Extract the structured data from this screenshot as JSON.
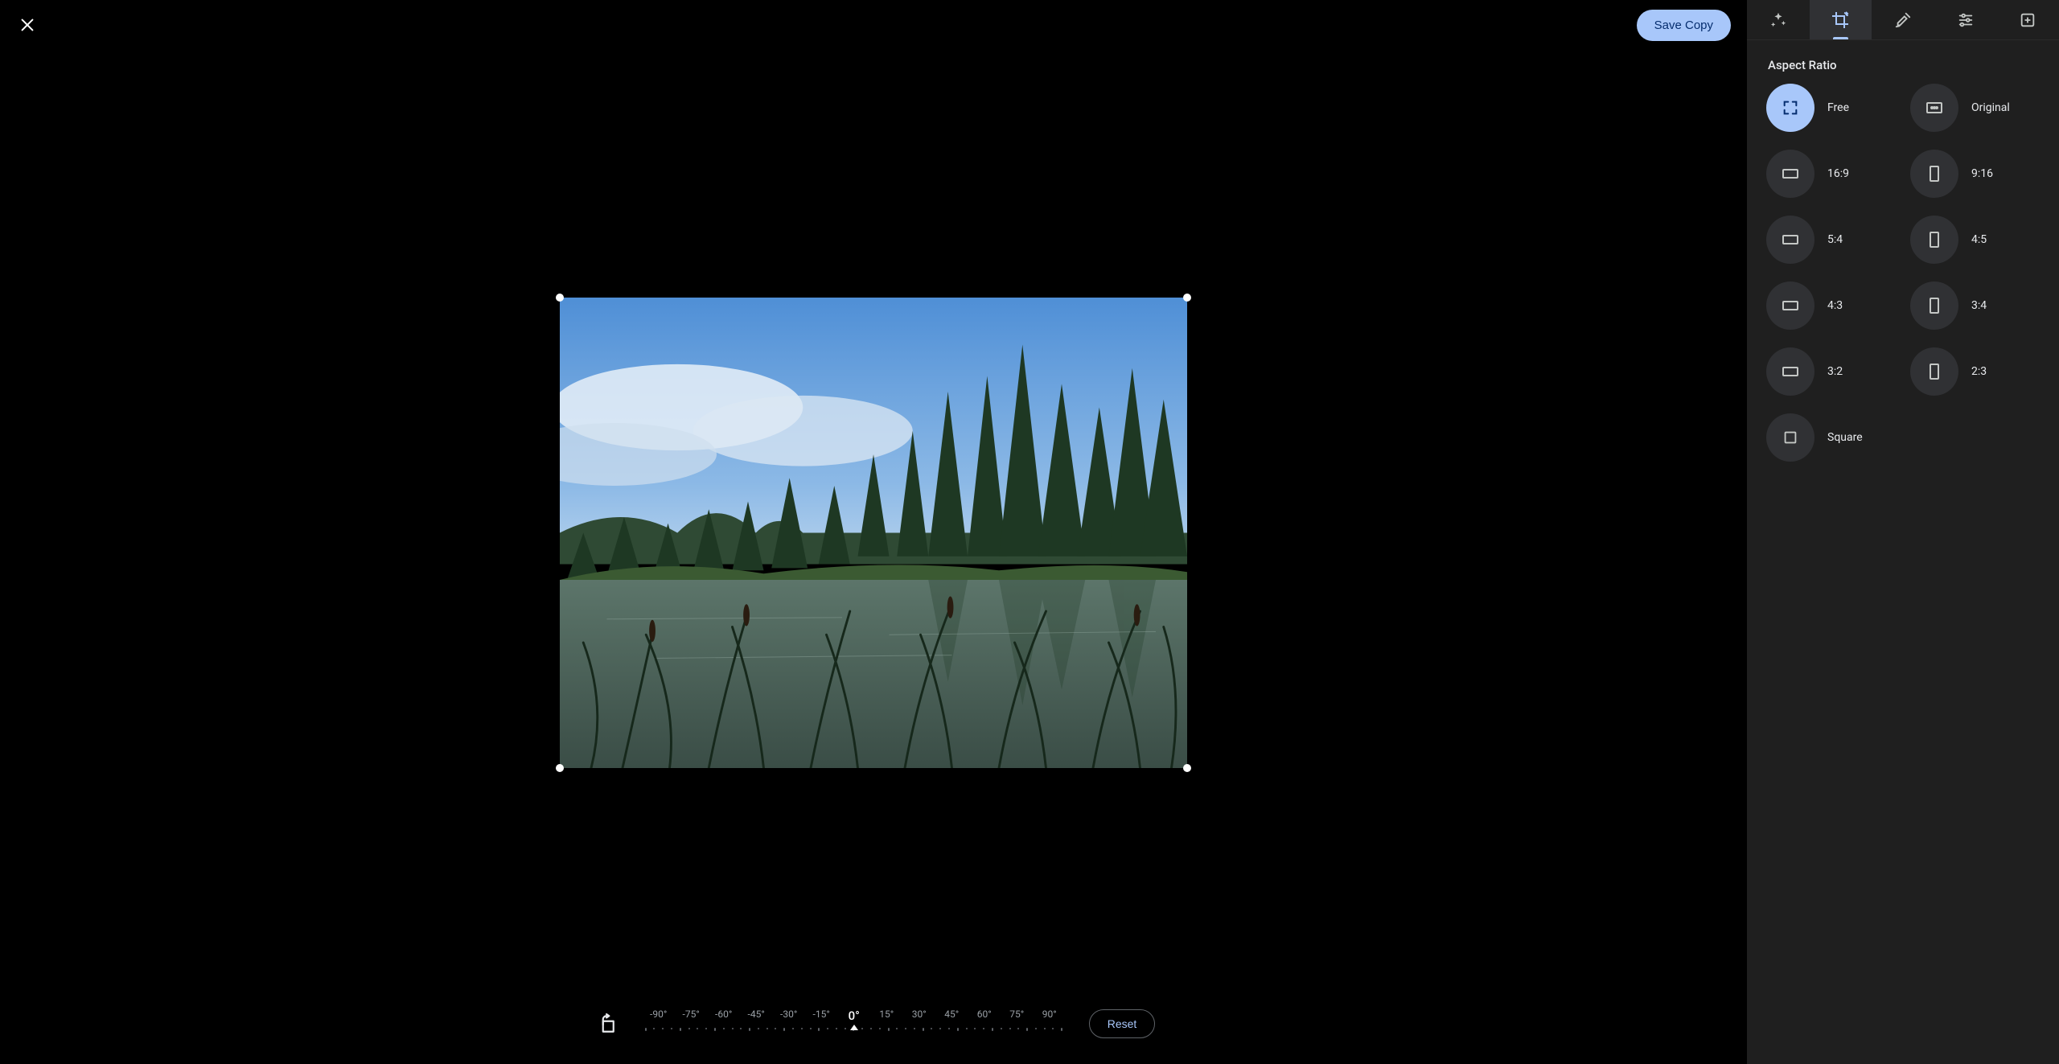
{
  "topbar": {
    "save_label": "Save Copy"
  },
  "rotate": {
    "reset_label": "Reset",
    "ticks": [
      "-90°",
      "-75°",
      "-60°",
      "-45°",
      "-30°",
      "-15°",
      "0°",
      "15°",
      "30°",
      "45°",
      "60°",
      "75°",
      "90°"
    ],
    "current_index": 6
  },
  "sidebar": {
    "tabs": [
      {
        "id": "enhance",
        "active": false
      },
      {
        "id": "crop",
        "active": true
      },
      {
        "id": "tools",
        "active": false
      },
      {
        "id": "adjust",
        "active": false
      },
      {
        "id": "more",
        "active": false
      }
    ],
    "section_title": "Aspect Ratio",
    "ratios": [
      {
        "id": "free",
        "label": "Free",
        "selected": true,
        "shape": "free"
      },
      {
        "id": "original",
        "label": "Original",
        "selected": false,
        "shape": "land"
      },
      {
        "id": "16-9",
        "label": "16:9",
        "selected": false,
        "shape": "land"
      },
      {
        "id": "9-16",
        "label": "9:16",
        "selected": false,
        "shape": "port"
      },
      {
        "id": "5-4",
        "label": "5:4",
        "selected": false,
        "shape": "land"
      },
      {
        "id": "4-5",
        "label": "4:5",
        "selected": false,
        "shape": "port"
      },
      {
        "id": "4-3",
        "label": "4:3",
        "selected": false,
        "shape": "land"
      },
      {
        "id": "3-4",
        "label": "3:4",
        "selected": false,
        "shape": "port"
      },
      {
        "id": "3-2",
        "label": "3:2",
        "selected": false,
        "shape": "land"
      },
      {
        "id": "2-3",
        "label": "2:3",
        "selected": false,
        "shape": "port"
      },
      {
        "id": "square",
        "label": "Square",
        "selected": false,
        "shape": "square"
      }
    ]
  }
}
